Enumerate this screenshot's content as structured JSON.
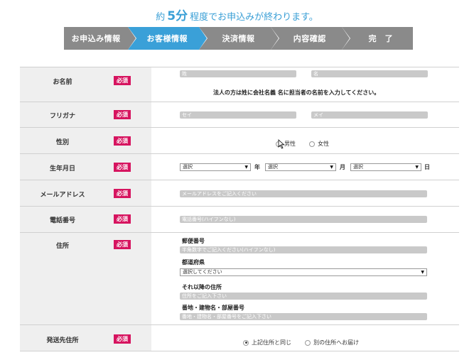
{
  "header": {
    "prefix": "約",
    "big": "5分",
    "suffix": "程度でお申込みが終わります。"
  },
  "steps": [
    {
      "label": "お申込み情報",
      "active": false
    },
    {
      "label": "お客様情報",
      "active": true
    },
    {
      "label": "決済情報",
      "active": false
    },
    {
      "label": "内容確認",
      "active": false
    },
    {
      "label": "完　了",
      "active": false
    }
  ],
  "required_badge": "必須",
  "form": {
    "name": {
      "label": "お名前",
      "last_placeholder": "姓",
      "first_placeholder": "名",
      "note": "法人の方は姓に会社名義 名に担当者の名前を入力してください。"
    },
    "furigana": {
      "label": "フリガナ",
      "last_placeholder": "セイ",
      "first_placeholder": "メイ"
    },
    "gender": {
      "label": "性別",
      "options": [
        "男性",
        "女性"
      ],
      "selected": null
    },
    "birthdate": {
      "label": "生年月日",
      "year_value": "選択",
      "month_value": "選択",
      "day_value": "選択",
      "year_unit": "年",
      "month_unit": "月",
      "day_unit": "日"
    },
    "email": {
      "label": "メールアドレス",
      "placeholder": "メールアドレスをご記入ください"
    },
    "phone": {
      "label": "電話番号",
      "placeholder": "電話番号(ハイフンなし)"
    },
    "address": {
      "label": "住所",
      "postal_label": "郵便番号",
      "postal_placeholder": "半角数字でご記入ください(ハイフンなし)",
      "prefecture_label": "都道府県",
      "prefecture_value": "選択してください",
      "rest_label": "それ以降の住所",
      "rest_placeholder": "住所をご記入下さい",
      "building_label": "番地・建物名・部屋番号",
      "building_placeholder": "番地・建物名・部屋番号をご記入下さい"
    },
    "shipping": {
      "label": "発送先住所",
      "options": [
        "上記住所と同じ",
        "別の住所へお届け"
      ],
      "selected": 0
    }
  }
}
